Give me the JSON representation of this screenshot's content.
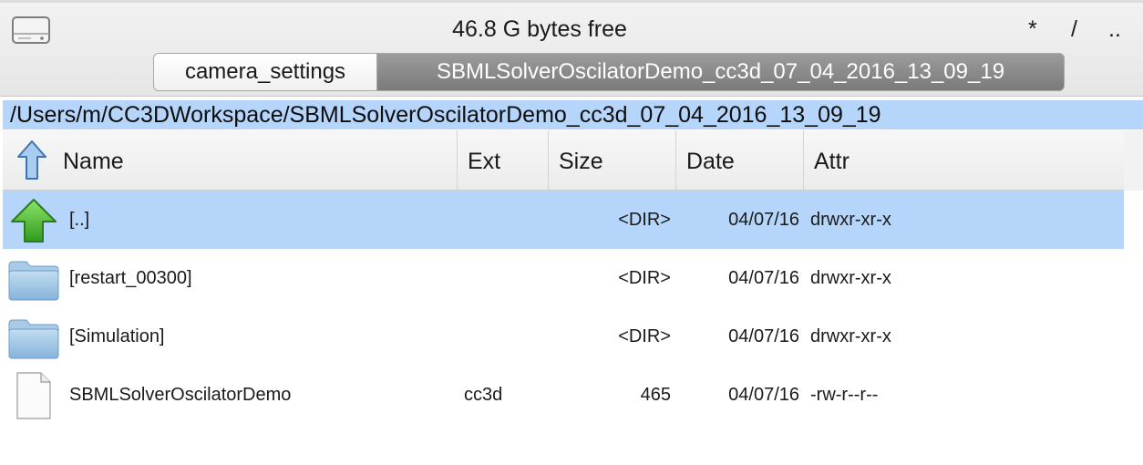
{
  "header": {
    "free_space": "46.8 G bytes free",
    "btn_star": "*",
    "btn_root": "/",
    "btn_up": ".."
  },
  "tabs": [
    {
      "label": "camera_settings",
      "active": false
    },
    {
      "label": "SBMLSolverOscilatorDemo_cc3d_07_04_2016_13_09_19",
      "active": true
    }
  ],
  "path": "/Users/m/CC3DWorkspace/SBMLSolverOscilatorDemo_cc3d_07_04_2016_13_09_19",
  "columns": {
    "name": "Name",
    "ext": "Ext",
    "size": "Size",
    "date": "Date",
    "attr": "Attr"
  },
  "rows": [
    {
      "name": "[..]",
      "ext": "",
      "size": "<DIR>",
      "date": "04/07/16",
      "attr": "drwxr-xr-x",
      "icon": "green-up-arrow-icon",
      "selected": true
    },
    {
      "name": "[restart_00300]",
      "ext": "",
      "size": "<DIR>",
      "date": "04/07/16",
      "attr": "drwxr-xr-x",
      "icon": "folder-icon",
      "selected": false
    },
    {
      "name": "[Simulation]",
      "ext": "",
      "size": "<DIR>",
      "date": "04/07/16",
      "attr": "drwxr-xr-x",
      "icon": "folder-icon",
      "selected": false
    },
    {
      "name": "SBMLSolverOscilatorDemo",
      "ext": "cc3d",
      "size": "465",
      "date": "04/07/16",
      "attr": "-rw-r--r--",
      "icon": "document-icon",
      "selected": false
    }
  ],
  "colors": {
    "selection": "#b5d5fb",
    "active_tab": "#8a8a8a",
    "folder": "#9cc3e0",
    "up_arrow": "#3fae2a"
  }
}
